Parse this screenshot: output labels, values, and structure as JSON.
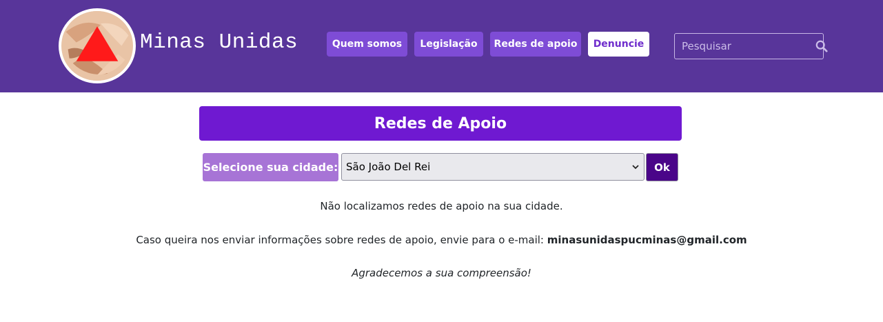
{
  "brand": {
    "name": "Minas Unidas"
  },
  "nav": {
    "items": [
      {
        "label": "Quem somos"
      },
      {
        "label": "Legislação"
      },
      {
        "label": "Redes de apoio"
      },
      {
        "label": "Denuncie"
      }
    ]
  },
  "search": {
    "placeholder": "Pesquisar",
    "icon": "search-icon"
  },
  "main": {
    "title": "Redes de Apoio",
    "city_label": "Selecione sua cidade:",
    "city_selected": "São João Del Rei",
    "ok_label": "Ok",
    "not_found": "Não localizamos redes de apoio na sua cidade.",
    "contact_text": "Caso queira nos enviar informações sobre redes de apoio, envie para o e-mail:",
    "contact_email": "minasunidaspucminas@gmail.com",
    "thanks": "Agradecemos a sua compreensão!"
  },
  "colors": {
    "header_bg": "#58359a",
    "nav_button": "#7e4cd6",
    "title_bar": "#6f19d1",
    "label_bg": "#a774d6",
    "ok_button": "#4a0589",
    "logo_triangle": "#ff1a1a"
  }
}
